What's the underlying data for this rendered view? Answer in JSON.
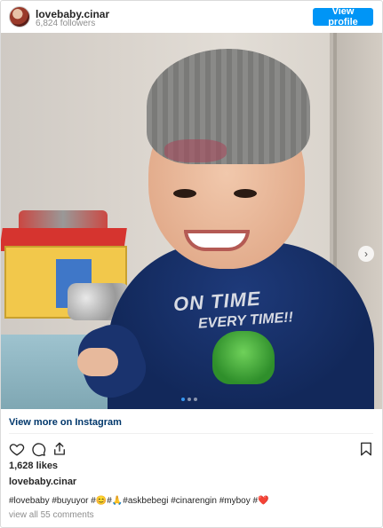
{
  "post": {
    "username": "lovebaby.cinar",
    "followers": "6,824 followers",
    "view_profile_label": "View profile",
    "photo": {
      "shirt_line1": "ON TIME",
      "shirt_line2": "EVERY TIME!!",
      "carousel_dots": 3,
      "active_dot": 1
    },
    "view_more_label": "View more on Instagram",
    "likes": "1,628 likes",
    "owner": "lovebaby.cinar",
    "caption": "#lovebaby #buyuyor #😊#🙏#askbebegi #cinarengin #myboy #❤️",
    "comments": "view all 55 comments",
    "icons": [
      "heart-icon",
      "comment-icon",
      "share-icon",
      "bookmark-icon",
      "chevron-right-icon"
    ],
    "colors": {
      "accent": "#0095f6",
      "link": "#00376b",
      "muted": "#8e8e8e",
      "heart": "#e0245e"
    }
  }
}
